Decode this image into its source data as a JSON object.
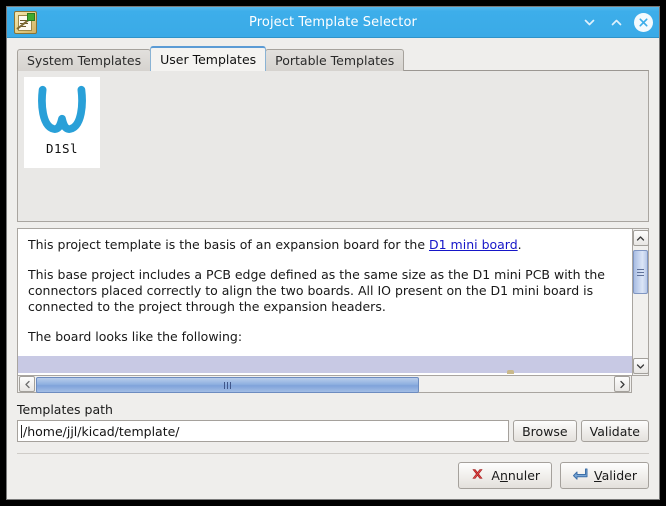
{
  "window": {
    "title": "Project Template Selector",
    "app_icon": "kicad-project-icon",
    "controls": {
      "minimize": "minimize-icon",
      "maximize": "maximize-icon",
      "close": "close-icon"
    }
  },
  "tabs": [
    {
      "label": "System Templates",
      "active": false
    },
    {
      "label": "User Templates",
      "active": true
    },
    {
      "label": "Portable Templates",
      "active": false
    }
  ],
  "templates": [
    {
      "label": "D1Sl",
      "logo": "wemos-d1-logo"
    }
  ],
  "description": {
    "paragraph1_before_link": "This project template is the basis of an expansion board for the ",
    "link_text": "D1 mini board",
    "paragraph1_after_link": ".",
    "paragraph2": "This base project includes a PCB edge defined as the same size as the D1 mini PCB with the connectors placed correctly to align the two boards. All IO present on the D1 mini board is connected to the project through the expansion headers.",
    "paragraph3": "The board looks like the following:"
  },
  "scrollbars": {
    "vertical_up": "chevron-up-icon",
    "vertical_down": "chevron-down-icon",
    "horizontal_left": "chevron-left-icon",
    "horizontal_right": "chevron-right-icon"
  },
  "path": {
    "label": "Templates path",
    "value": "/home/jjl/kicad/template/",
    "placeholder": "",
    "browse_label": "Browse",
    "validate_label": "Validate"
  },
  "footer": {
    "cancel": {
      "prefix": "A",
      "accel": "n",
      "suffix": "nuler",
      "icon": "red-x-icon"
    },
    "ok": {
      "prefix": "",
      "accel": "V",
      "suffix": "alider",
      "icon": "enter-arrow-icon"
    }
  },
  "colors": {
    "titlebar": "#3daeea",
    "accent_blue": "#29a0d8",
    "link": "#1616c8",
    "selection": "#c8c9e4",
    "window_bg": "#efeeec"
  }
}
